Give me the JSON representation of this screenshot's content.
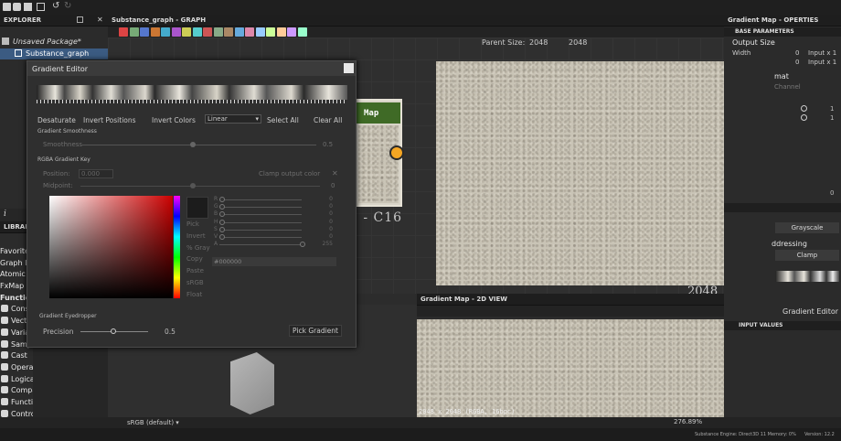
{
  "explorer": {
    "title": "EXPLORER",
    "package": "Unsaved Package*",
    "graph": "Substance_graph"
  },
  "graph": {
    "title": "Substance_graph - GRAPH",
    "parent_size_label": "Parent Size:",
    "parent_size_value": "2048",
    "size_value": "2048",
    "node_label": "Gradient Map",
    "node_caption": "2048x2048 - C16"
  },
  "viewer2d": {
    "title": "Gradient Map - 2D VIEW",
    "footer": "2048 x 2048 (RGBA, 16bpc)",
    "zoom": "276.89%",
    "colorspace": "sRGB (default)"
  },
  "big_preview": {
    "size_label": "2048"
  },
  "library": {
    "title": "LIBRARY",
    "items": [
      "Favorites",
      "Graph Items",
      "Atomic Nodes",
      "FxMap Nodes",
      "Function",
      "Constant",
      "Vector",
      "Variables",
      "Sample",
      "Cast",
      "Operator",
      "Logical",
      "Comparison",
      "Function",
      "Control"
    ]
  },
  "properties": {
    "title": "Gradient Map - OPERTIES",
    "section_base": "BASE PARAMETERS",
    "output_size_label": "Output Size",
    "width_label": "Width",
    "height_label": "Height",
    "width_val": "0",
    "height_val": "0",
    "width_mode": "Input x 1",
    "height_mode": "Input x 1",
    "format_label": "Output Format",
    "channel_label": "Channel",
    "val1": "1",
    "val2": "1",
    "val0": "0",
    "grayscale": "Grayscale",
    "addressing_label": "Addressing",
    "clamp": "Clamp",
    "section_params": "PARAMETERS",
    "gradient_editor_btn": "Gradient Editor",
    "section_input": "INPUT VALUES"
  },
  "dialog": {
    "title": "Gradient Editor",
    "toolbar": {
      "desaturate": "Desaturate",
      "invert_positions": "Invert Positions",
      "invert_colors": "Invert Colors",
      "interp": "Linear",
      "select_all": "Select All",
      "clear_all": "Clear All"
    },
    "smoothness_header": "Gradient Smoothness",
    "smoothness_label": "Smoothness",
    "smoothness_value": "0.5",
    "key_header": "RGBA Gradient Key",
    "position_label": "Position:",
    "position_value": "0.000",
    "clamp_label": "Clamp output color",
    "midpoint_label": "Midpoint:",
    "midpoint_value": "0",
    "side_buttons": [
      "Pick",
      "Invert",
      "% Gray",
      "Copy",
      "Paste",
      "sRGB",
      "Float"
    ],
    "channels": [
      {
        "name": "R",
        "value": "0"
      },
      {
        "name": "G",
        "value": "0"
      },
      {
        "name": "B",
        "value": "0"
      },
      {
        "name": "H",
        "value": "0"
      },
      {
        "name": "S",
        "value": "0"
      },
      {
        "name": "V",
        "value": "0"
      },
      {
        "name": "A",
        "value": "255"
      }
    ],
    "hex_value": "#000000",
    "eyedropper_header": "Gradient Eyedropper",
    "precision_label": "Precision",
    "precision_value": "0.5",
    "pick_gradient": "Pick Gradient"
  },
  "status": {
    "engine": "Substance Engine: Direct3D 11  Memory: 0%",
    "version": "Version: 12.2"
  },
  "colors": {
    "node_header": "#3f6a26",
    "connector": "#f5a623",
    "bg": "#262626"
  }
}
